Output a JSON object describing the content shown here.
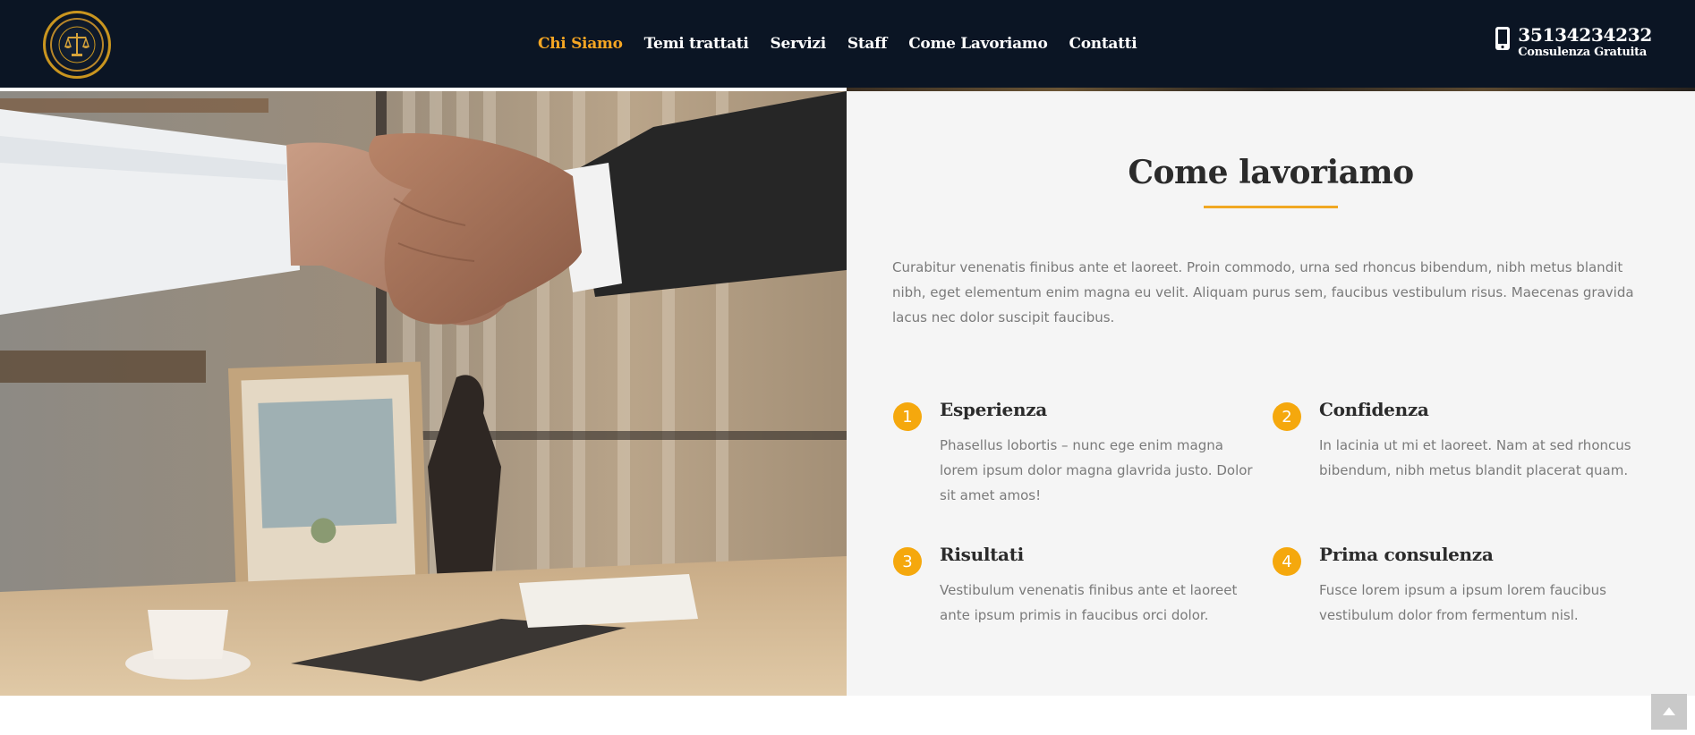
{
  "header": {
    "logo_icon": "law-firm-seal-logo",
    "nav": [
      {
        "label": "Chi Siamo",
        "active": true
      },
      {
        "label": "Temi trattati",
        "active": false
      },
      {
        "label": "Servizi",
        "active": false
      },
      {
        "label": "Staff",
        "active": false
      },
      {
        "label": "Come Lavoriamo",
        "active": false
      },
      {
        "label": "Contatti",
        "active": false
      }
    ],
    "contact": {
      "icon": "mobile-phone-icon",
      "phone": "35134234232",
      "subtitle": "Consulenza Gratuita"
    }
  },
  "hero_image": {
    "icon": "handshake-photo"
  },
  "section": {
    "title": "Come lavoriamo",
    "intro": "Curabitur venenatis finibus ante et laoreet. Proin commodo, urna sed rhoncus bibendum, nibh metus blandit nibh, eget elementum enim magna eu velit. Aliquam purus sem, faucibus vestibulum risus. Maecenas gravida lacus nec dolor suscipit faucibus.",
    "features": [
      {
        "num": "1",
        "title": "Esperienza",
        "desc": "Phasellus lobortis – nunc ege enim magna lorem ipsum dolor magna glavrida justo. Dolor sit amet amos!"
      },
      {
        "num": "2",
        "title": "Confidenza",
        "desc": "In lacinia ut mi et laoreet. Nam at sed rhoncus bibendum, nibh metus blandit placerat quam."
      },
      {
        "num": "3",
        "title": "Risultati",
        "desc": "Vestibulum venenatis finibus ante et laoreet ante ipsum primis in faucibus orci dolor."
      },
      {
        "num": "4",
        "title": "Prima consulenza",
        "desc": "Fusce lorem ipsum a ipsum lorem faucibus vestibulum dolor from fermentum nisl."
      }
    ]
  },
  "colors": {
    "header_bg": "#0b1524",
    "accent": "#f5a623",
    "panel_bg": "#f5f5f5"
  },
  "scroll_top_icon": "arrow-up-icon"
}
